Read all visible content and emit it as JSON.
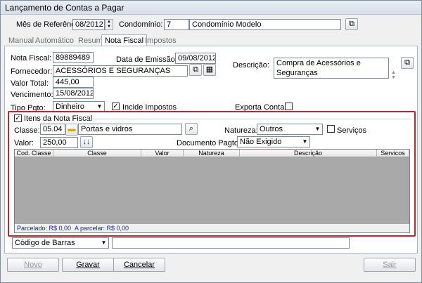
{
  "window": {
    "title": "Lançamento de Contas a Pagar"
  },
  "header": {
    "mes_label": "Mês de Referência:",
    "mes_value": "08/2012",
    "condominio_label": "Condomínio:",
    "condominio_code": "7",
    "condominio_name": "Condomínio Modelo"
  },
  "tabs": [
    "Manual",
    "Automático",
    "Resumo",
    "Nota Fiscal",
    "Impostos"
  ],
  "form": {
    "nota_label": "Nota Fiscal:",
    "nota_value": "89889489",
    "emissao_label": "Data de Emissão NF:",
    "emissao_value": "09/08/2012",
    "descricao_label": "Descrição:",
    "descricao_value": "Compra de Acessórios e Seguranças",
    "fornecedor_label": "Fornecedor:",
    "fornecedor_value": "ACESSÓRIOS E SEGURANÇAS",
    "valor_total_label": "Valor Total:",
    "valor_total_value": "445,00",
    "vencimento_label": "Vencimento:",
    "vencimento_value": "15/08/2012",
    "tipo_pgto_label": "Tipo Pgto:",
    "tipo_pgto_value": "Dinheiro",
    "incide_label": "Incide Impostos",
    "exporta_label": "Exporta Contabil"
  },
  "itens": {
    "group_label": "Itens da Nota Fiscal",
    "classe_label": "Classe:",
    "classe_code": "05.04",
    "classe_name": "Portas e vidros",
    "natureza_label": "Natureza:",
    "natureza_value": "Outros",
    "servicos_label": "Serviços",
    "valor_label": "Valor:",
    "valor_value": "250,00",
    "doc_label": "Documento Pagto:",
    "doc_value": "Não Exigido",
    "columns": [
      "Cod. Classe",
      "Classe",
      "Valor",
      "Natureza",
      "Descrição",
      "Servicos"
    ],
    "parcelado": "Parcelado: R$ 0,00",
    "a_parcelar": "A parcelar: R$ 0,00"
  },
  "barcode": {
    "type_value": "Código de Barras",
    "value": ""
  },
  "buttons": {
    "novo": "Novo",
    "gravar": "Gravar",
    "cancelar": "Cancelar",
    "sair": "Sair"
  }
}
